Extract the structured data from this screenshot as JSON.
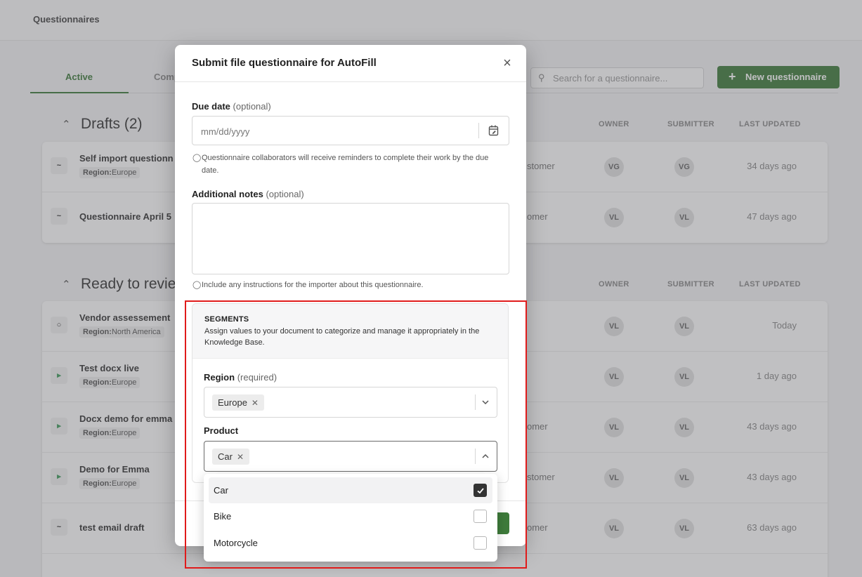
{
  "topbar": {
    "breadcrumb": "Questionnaires"
  },
  "tabs": [
    {
      "label": "Active"
    },
    {
      "label": "Comp"
    }
  ],
  "search": {
    "placeholder": "Search for a questionnaire..."
  },
  "new_button": {
    "label": "New questionnaire"
  },
  "columns": {
    "owner": "OWNER",
    "submitter": "SUBMITTER",
    "last_updated": "LAST UPDATED"
  },
  "drafts": {
    "title": "Drafts (2)",
    "rows": [
      {
        "name": "Self import questionn",
        "tag_key": "Region:",
        "tag_value": "Europe",
        "source": "stomer",
        "owner": "VG",
        "submitter": "VG",
        "updated": "34 days ago"
      },
      {
        "name": "Questionnaire April 5",
        "source": "omer",
        "owner": "VL",
        "submitter": "VL",
        "updated": "47 days ago"
      }
    ]
  },
  "ready": {
    "title": "Ready to revie",
    "rows": [
      {
        "name": "Vendor assessement",
        "tag_key": "Region:",
        "tag_value": "North America",
        "owner": "VL",
        "submitter": "VL",
        "updated": "Today"
      },
      {
        "name": "Test docx live",
        "tag_key": "Region:",
        "tag_value": "Europe",
        "owner": "VL",
        "submitter": "VL",
        "updated": "1 day ago"
      },
      {
        "name": "Docx demo for emma",
        "tag_key": "Region:",
        "tag_value": "Europe",
        "source": "omer",
        "owner": "VL",
        "submitter": "VL",
        "updated": "43 days ago"
      },
      {
        "name": "Demo for Emma",
        "tag_key": "Region:",
        "tag_value": "Europe",
        "source": "stomer",
        "owner": "VL",
        "submitter": "VL",
        "updated": "43 days ago"
      },
      {
        "name": "test email draft",
        "source": "omer",
        "owner": "VL",
        "submitter": "VL",
        "updated": "63 days ago"
      }
    ]
  },
  "modal": {
    "title": "Submit file questionnaire for AutoFill",
    "due_date": {
      "label": "Due date",
      "optional": "(optional)",
      "placeholder": "mm/dd/yyyy",
      "hint": "Questionnaire collaborators will receive reminders to complete their work by the due date."
    },
    "notes": {
      "label": "Additional notes",
      "optional": "(optional)",
      "value": "",
      "hint": "Include any instructions for the importer about this questionnaire."
    },
    "segments": {
      "title": "SEGMENTS",
      "description": "Assign values to your document to categorize and manage it appropriately in the Knowledge Base.",
      "region": {
        "label": "Region",
        "required": "(required)",
        "selected": "Europe"
      },
      "product": {
        "label": "Product",
        "selected": "Car",
        "options": [
          {
            "label": "Car",
            "checked": true
          },
          {
            "label": "Bike",
            "checked": false
          },
          {
            "label": "Motorcycle",
            "checked": false
          }
        ]
      }
    }
  },
  "colors": {
    "accent": "#3e7b3b",
    "annotation": "#e01b1b"
  }
}
